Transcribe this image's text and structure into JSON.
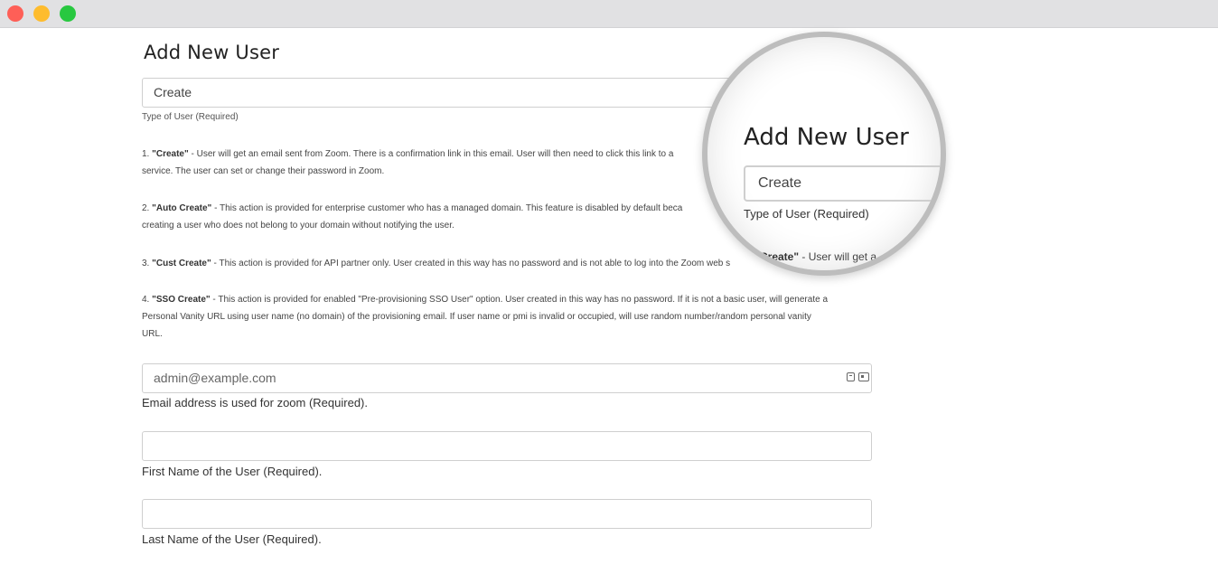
{
  "form": {
    "title": "Add New User",
    "user_type": {
      "value": "Create",
      "label": "Type of User (Required)"
    },
    "descriptions": [
      {
        "num": "1.",
        "term": "\"Create\"",
        "text": " - User will get an email sent from Zoom. There is a confirmation link in this email. User will then need to click this link to a",
        "text2": "service. The user can set or change their password in Zoom."
      },
      {
        "num": "2.",
        "term": "\"Auto Create\"",
        "text": " - This action is provided for enterprise customer who has a managed domain. This feature is disabled by default beca",
        "text2": "creating a user who does not belong to your domain without notifying the user."
      },
      {
        "num": "3.",
        "term": "\"Cust Create\"",
        "text": " - This action is provided for API partner only. User created in this way has no password and is not able to log into the Zoom web s"
      },
      {
        "num": "4.",
        "term": "\"SSO Create\"",
        "text": " - This action is provided for enabled \"Pre-provisioning SSO User\" option. User created in this way has no password. If it is not a basic user, will generate a",
        "text2": "Personal Vanity URL using user name (no domain) of the provisioning email. If user name or pmi is invalid or occupied, will use random number/random personal vanity",
        "text3": "URL."
      }
    ],
    "email": {
      "placeholder": "admin@example.com",
      "label": "Email address is used for zoom (Required)."
    },
    "first_name": {
      "value": "",
      "label": "First Name of the User (Required)."
    },
    "last_name": {
      "value": "",
      "label": "Last Name of the User (Required)."
    }
  },
  "magnifier": {
    "title": "Add New User",
    "value": "Create",
    "label": "Type of User (Required)",
    "partial_term": "Create\"",
    "partial_text": " - User will get a"
  },
  "window": {
    "controls": [
      "close",
      "minimize",
      "maximize"
    ]
  }
}
